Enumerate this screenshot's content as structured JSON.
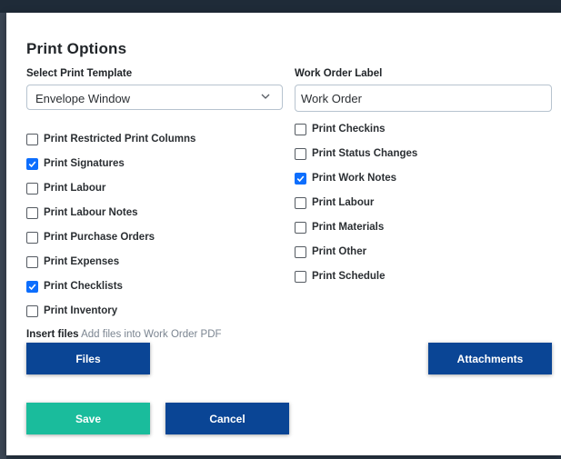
{
  "dialog": {
    "title": "Print Options"
  },
  "template": {
    "label": "Select Print Template",
    "selected": "Envelope Window"
  },
  "work_order_label": {
    "label": "Work Order Label",
    "value": "Work Order"
  },
  "left_options": [
    {
      "label": "Print Restricted Print Columns",
      "checked": false
    },
    {
      "label": "Print Signatures",
      "checked": true
    },
    {
      "label": "Print Labour",
      "checked": false
    },
    {
      "label": "Print Labour Notes",
      "checked": false
    },
    {
      "label": "Print Purchase Orders",
      "checked": false
    },
    {
      "label": "Print Expenses",
      "checked": false
    },
    {
      "label": "Print Checklists",
      "checked": true
    },
    {
      "label": "Print Inventory",
      "checked": false
    }
  ],
  "right_options": [
    {
      "label": "Print Checkins",
      "checked": false
    },
    {
      "label": "Print Status Changes",
      "checked": false
    },
    {
      "label": "Print Work Notes",
      "checked": true
    },
    {
      "label": "Print Labour",
      "checked": false
    },
    {
      "label": "Print Materials",
      "checked": false
    },
    {
      "label": "Print Other",
      "checked": false
    },
    {
      "label": "Print Schedule",
      "checked": false
    }
  ],
  "insert_files": {
    "label": "Insert files",
    "hint": "Add files into Work Order PDF"
  },
  "buttons": {
    "files": "Files",
    "attachments": "Attachments",
    "save": "Save",
    "cancel": "Cancel"
  },
  "colors": {
    "primary": "#0a4595",
    "save": "#1abc9c",
    "checkbox_checked": "#0d6efd"
  },
  "icons": {
    "select_chevron": "chevron-down-icon",
    "checkbox_check": "check-icon"
  }
}
